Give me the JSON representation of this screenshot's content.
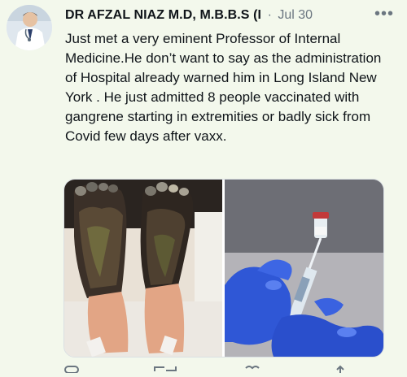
{
  "tweet": {
    "author": "DR AFZAL NIAZ M.D, M.B.B.S (I",
    "separator": "·",
    "date": "Jul 30",
    "more_icon": "more-horizontal-icon",
    "text": "Just met a very eminent Professor of Internal Medicine.He don’t want to say as the administration of Hospital already warned him in Long Island New York . He  just admitted 8 people  vaccinated with gangrene starting in extremities or badly sick from  Covid few days after vaxx.",
    "actions": [
      "reply-icon",
      "retweet-icon",
      "like-icon",
      "share-icon"
    ]
  },
  "colors": {
    "background": "#f3f8ec",
    "text": "#0f1419",
    "secondary": "#6b7680",
    "glove": "#2f57d6"
  }
}
